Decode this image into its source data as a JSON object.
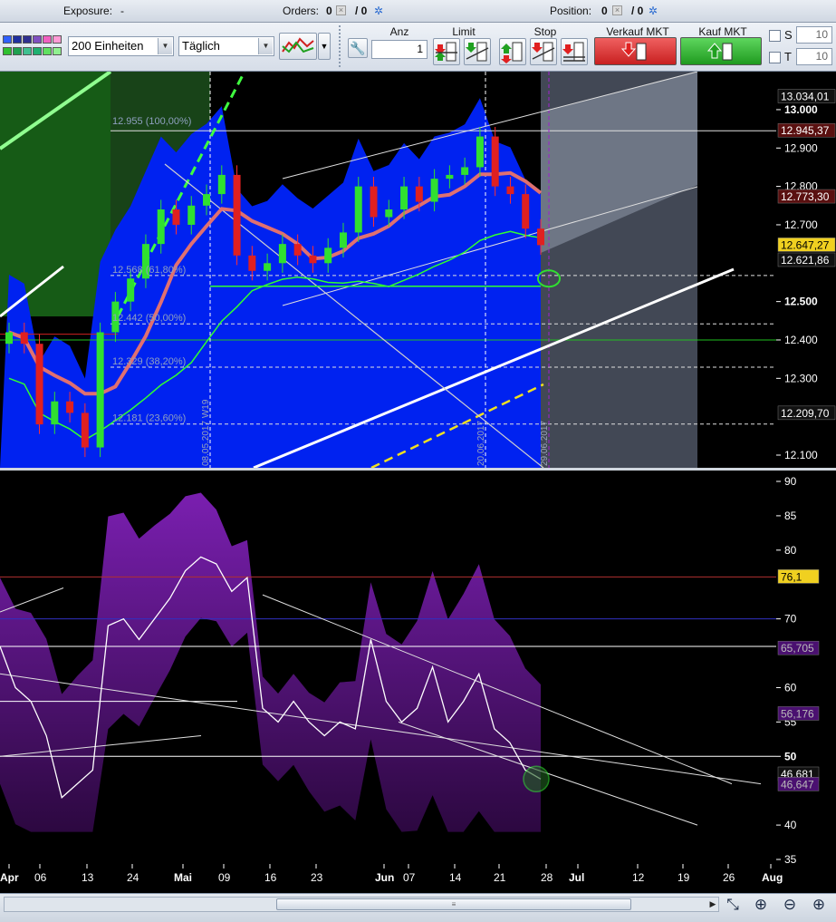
{
  "status": {
    "exposure_label": "Exposure:",
    "exposure_value": "-",
    "orders_label": "Orders:",
    "orders_value": "0",
    "orders_sep": "/ 0",
    "position_label": "Position:",
    "position_value": "0",
    "position_sep": "/ 0"
  },
  "toolbar": {
    "swatch_colors_top": [
      "#3060ff",
      "#2030a0",
      "#303090",
      "#8050c0",
      "#f060c0",
      "#ff9ad5"
    ],
    "swatch_colors_bottom": [
      "#30c030",
      "#20a050",
      "#40c090",
      "#20b070",
      "#60e060",
      "#90f090"
    ],
    "quantity_select": "200 Einheiten",
    "period_select": "Täglich",
    "anz_label": "Anz",
    "anz_value": "1",
    "limit_label": "Limit",
    "stop_label": "Stop",
    "sell_label": "Verkauf MKT",
    "buy_label": "Kauf MKT",
    "s_label": "S",
    "s_value": "10",
    "t_label": "T",
    "t_value": "10",
    "sell_color": "#e03030",
    "buy_color": "#2ea82e"
  },
  "price_axis": {
    "ticks": [
      "13.000",
      "12.900",
      "12.800",
      "12.700",
      "12.500",
      "12.400",
      "12.300",
      "12.100"
    ],
    "badges": [
      {
        "text": "13.034,01",
        "style": "dark"
      },
      {
        "text": "12.945,37",
        "style": "red"
      },
      {
        "text": "12.773,30",
        "style": "red"
      },
      {
        "text": "12.647,27",
        "style": "yellow"
      },
      {
        "text": "12.621,86",
        "style": "dark"
      },
      {
        "text": "12.209,70",
        "style": "dark"
      }
    ]
  },
  "fib_labels": [
    "12.955 (100,00%)",
    "12.568 (61,80%)",
    "12.442 (50,00%)",
    "12.329 (38,20%)",
    "12.181 (23,60%)"
  ],
  "date_markers": [
    "08.05.2017 W19",
    "20.06.2017",
    "29.06.2017"
  ],
  "osc_axis": {
    "ticks": [
      "90",
      "85",
      "80",
      "70",
      "60",
      "55",
      "50",
      "40",
      "35"
    ],
    "badges": [
      {
        "text": "76,1",
        "style": "yellow"
      },
      {
        "text": "65,705",
        "style": "purple"
      },
      {
        "text": "56,176",
        "style": "purple"
      },
      {
        "text": "46,681",
        "style": "dark"
      },
      {
        "text": "46,647",
        "style": "purple"
      }
    ]
  },
  "time_axis": [
    "Apr",
    "06",
    "13",
    "24",
    "Mai",
    "09",
    "16",
    "23",
    "Jun",
    "07",
    "14",
    "21",
    "28",
    "Jul",
    "12",
    "19",
    "26",
    "Aug"
  ],
  "chart_data": [
    {
      "type": "candlestick",
      "title": "",
      "ylim": [
        12100,
        13040
      ],
      "approx_closes": [
        12420,
        12390,
        12180,
        12240,
        12210,
        12120,
        12420,
        12500,
        12560,
        12650,
        12740,
        12700,
        12750,
        12780,
        12830,
        12620,
        12580,
        12600,
        12650,
        12620,
        12600,
        12640,
        12680,
        12800,
        12720,
        12740,
        12800,
        12760,
        12820,
        12830,
        12850,
        12930,
        12800,
        12780,
        12690,
        12647
      ],
      "markers": {
        "last": 12647.27,
        "high": 13034.01,
        "fib_100": 12945.37,
        "ema": 12773.3,
        "prev": 12621.86,
        "low_band": 12209.7
      }
    },
    {
      "type": "line",
      "title": "",
      "ylim": [
        35,
        90
      ],
      "levels": [
        76.1,
        70,
        65.705,
        56.176,
        50,
        46.681,
        46.647
      ],
      "oscillator_values": [
        66,
        60,
        58,
        53,
        44,
        46,
        48,
        69,
        70,
        67,
        70,
        73,
        77,
        79,
        78,
        74,
        76,
        57,
        55,
        58,
        55,
        53,
        55,
        54,
        67,
        58,
        55,
        57,
        63,
        55,
        58,
        62,
        54,
        52,
        48,
        46.7
      ]
    }
  ]
}
